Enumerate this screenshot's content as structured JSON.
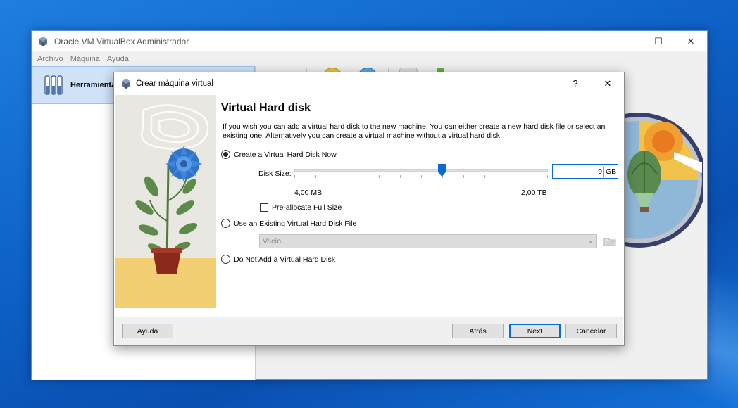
{
  "main_window": {
    "title": "Oracle VM VirtualBox Administrador",
    "controls": {
      "minimize": "—",
      "maximize": "☐",
      "close": "✕"
    },
    "menu": [
      "Archivo",
      "Máquina",
      "Ayuda"
    ],
    "tools_label": "Herramientas"
  },
  "dialog": {
    "title": "Crear máquina virtual",
    "help_glyph": "?",
    "close_glyph": "✕",
    "heading": "Virtual Hard disk",
    "description": "If you wish you can add a virtual hard disk to the new machine. You can either create a new hard disk file or select an existing one. Alternatively you can create a virtual machine without a virtual hard disk.",
    "options": {
      "create_new": "Create a Virtual Hard Disk Now",
      "use_existing": "Use an Existing Virtual Hard Disk File",
      "no_disk": "Do Not Add a Virtual Hard Disk",
      "selected": "create_new"
    },
    "disk_size": {
      "label": "Disk Size:",
      "value": "9",
      "unit": "GB",
      "min_label": "4,00 MB",
      "max_label": "2,00 TB"
    },
    "preallocate_label": "Pre-allocate Full Size",
    "preallocate_checked": false,
    "existing_file_combo": "Vacío",
    "buttons": {
      "help": "Ayuda",
      "back": "Atrás",
      "next": "Next",
      "cancel": "Cancelar"
    }
  },
  "colors": {
    "accent": "#0a6ad1",
    "selection": "#cfe2f8",
    "desktop": "#0d5fc4"
  }
}
